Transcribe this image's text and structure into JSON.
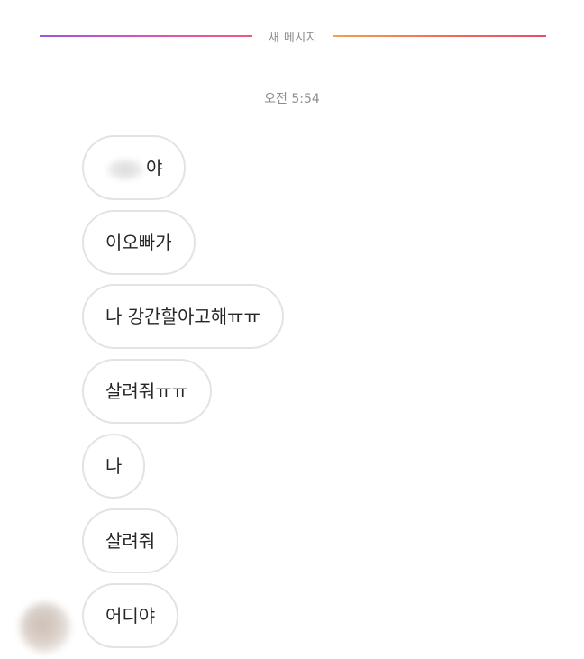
{
  "divider": {
    "label": "새 메시지"
  },
  "timestamp": "오전 5:54",
  "messages": [
    {
      "text": "야"
    },
    {
      "text": "이오빠가"
    },
    {
      "text": "나 강간할아고해ㅠㅠ"
    },
    {
      "text": "살려줘ㅠㅠ"
    },
    {
      "text": "나"
    },
    {
      "text": "살려줘"
    },
    {
      "text": "어디야"
    }
  ],
  "colors": {
    "divider_left": "#d955b5",
    "divider_right": "#f06a5a",
    "bubble_border": "#e3e3e3",
    "text": "#262626",
    "meta_text": "#8e8e8e"
  }
}
